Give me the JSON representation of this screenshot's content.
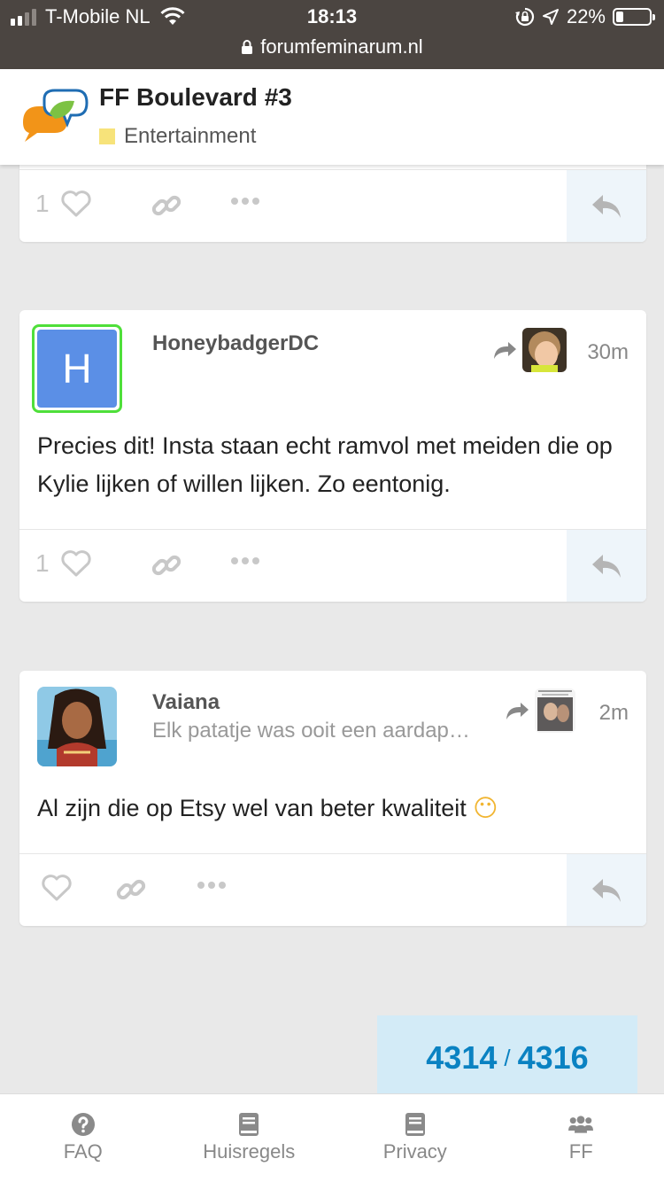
{
  "status_bar": {
    "carrier": "T-Mobile NL",
    "time": "18:13",
    "battery": "22%",
    "url": "forumfeminarum.nl"
  },
  "header": {
    "title": "FF Boulevard #3",
    "category": "Entertainment",
    "category_color": "#f7e37a"
  },
  "posts": [
    {
      "likes": "1"
    },
    {
      "avatar_letter": "H",
      "username": "HoneybadgerDC",
      "time": "30m",
      "body": "Precies dit! Insta staan echt ramvol met meiden die op Kylie lijken of willen lijken. Zo eentonig.",
      "likes": "1"
    },
    {
      "username": "Vaiana",
      "user_title": "Elk patatje was ooit een aardap…",
      "time": "2m",
      "body": "Al zijn die op Etsy wel van beter kwaliteit",
      "emoji": "😶"
    }
  ],
  "progress": {
    "current": "4314",
    "separator": "/",
    "total": "4316"
  },
  "bottom_nav": [
    {
      "label": "FAQ",
      "icon": "question-circle-icon"
    },
    {
      "label": "Huisregels",
      "icon": "book-icon"
    },
    {
      "label": "Privacy",
      "icon": "book-icon"
    },
    {
      "label": "FF",
      "icon": "users-icon"
    }
  ]
}
